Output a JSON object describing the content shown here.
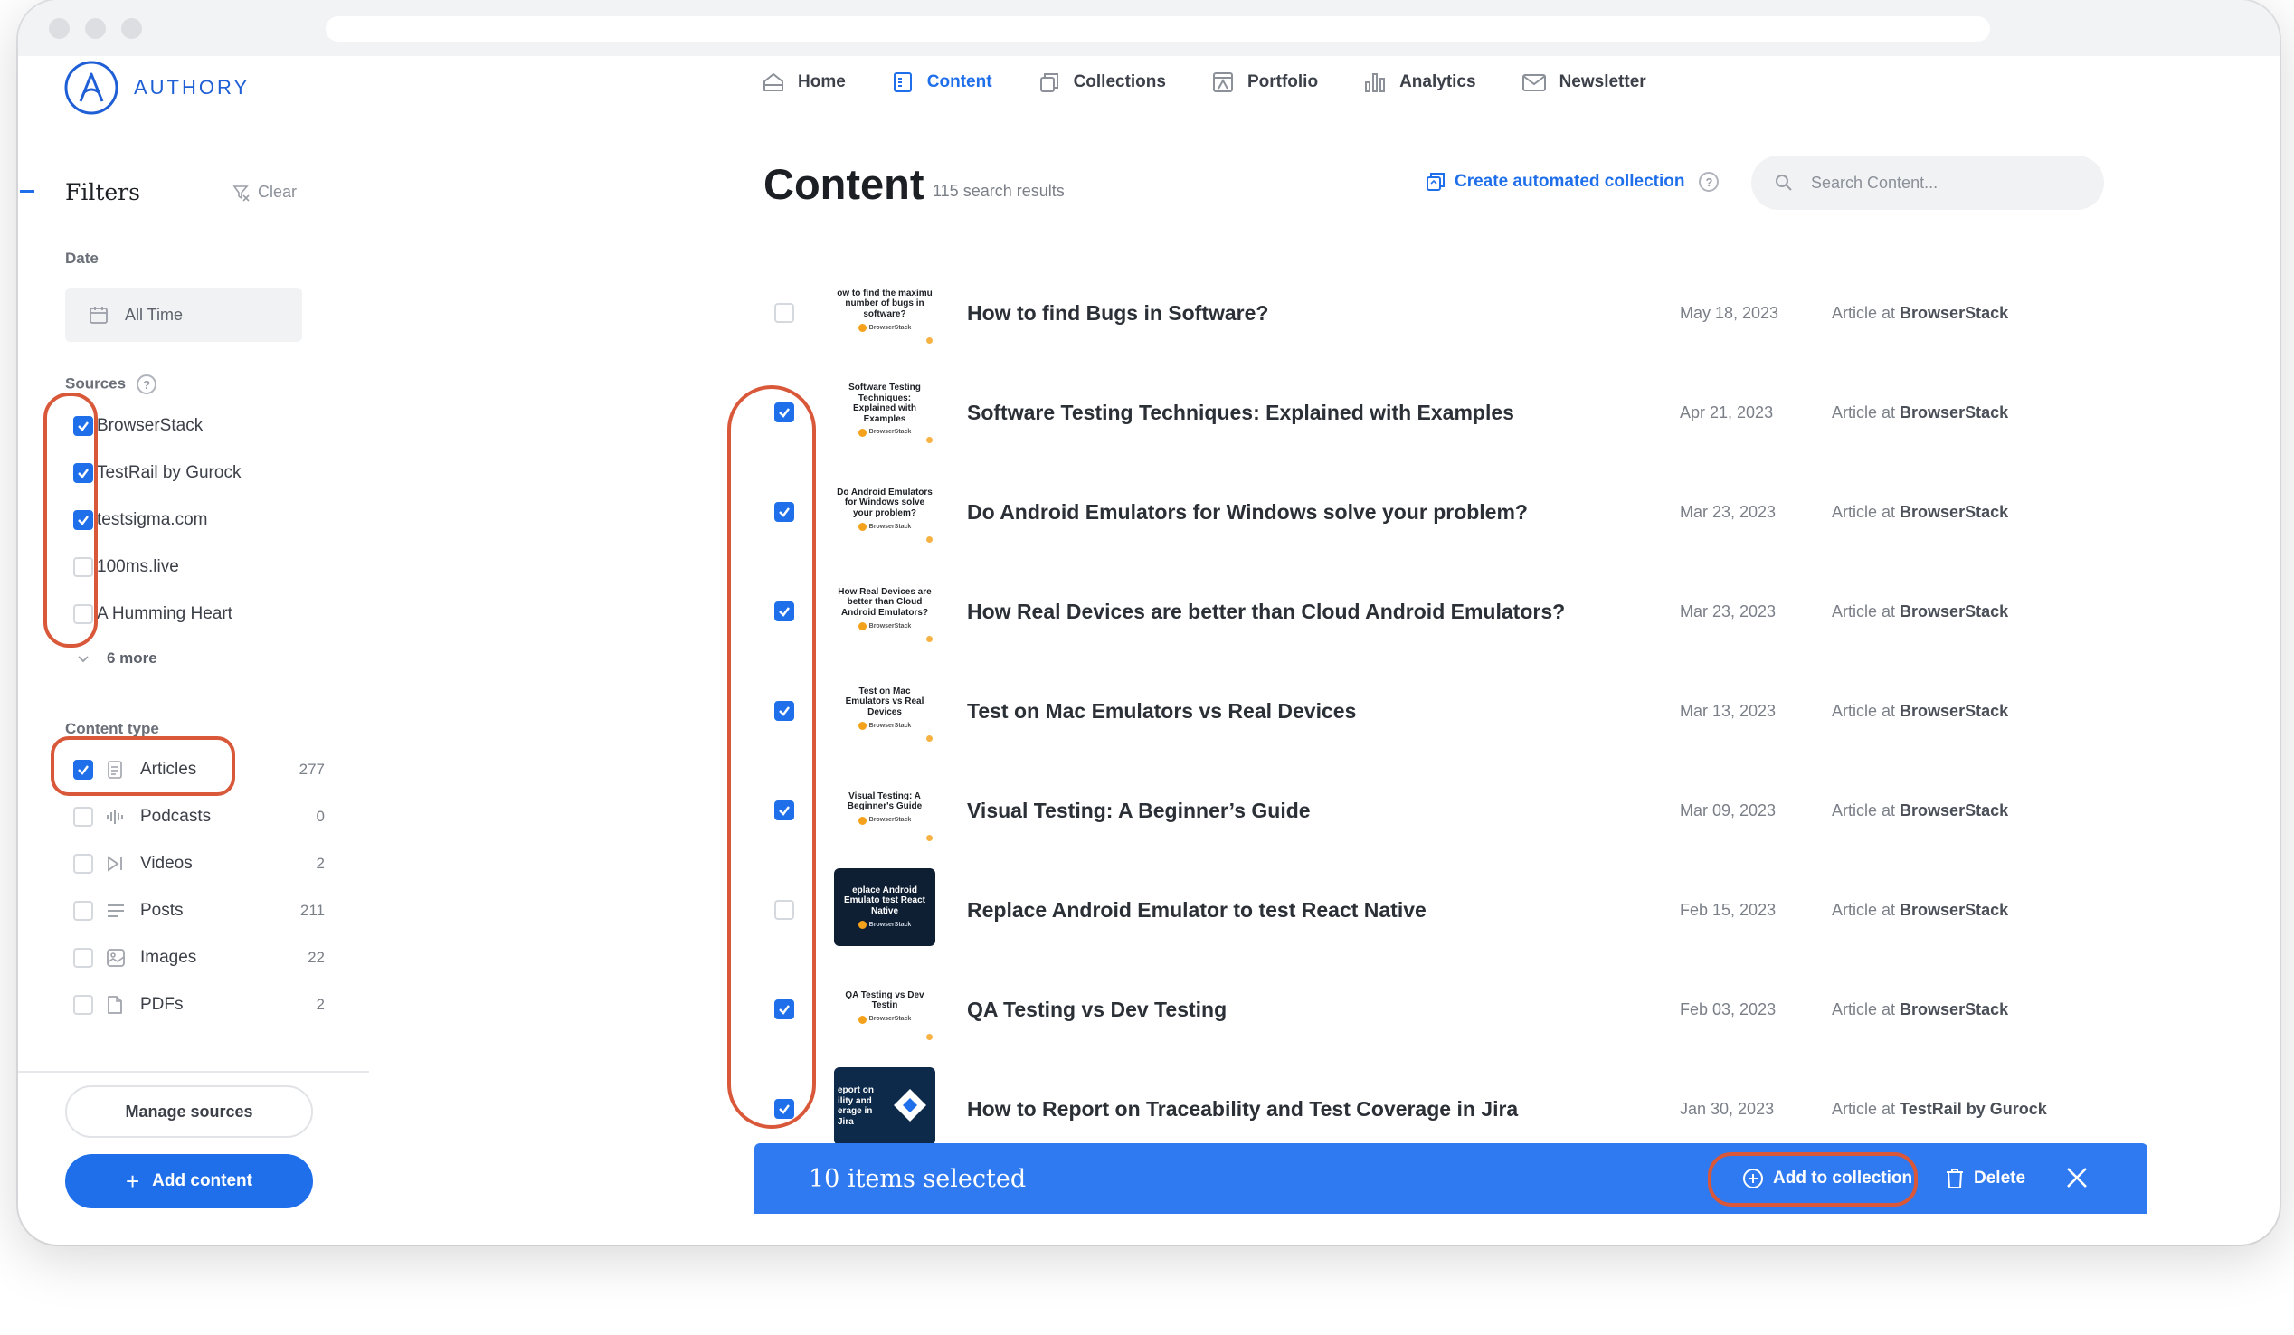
{
  "app": {
    "name": "AUTHORY"
  },
  "nav": [
    {
      "label": "Home",
      "icon": "home-icon"
    },
    {
      "label": "Content",
      "icon": "content-icon",
      "active": true
    },
    {
      "label": "Collections",
      "icon": "collections-icon"
    },
    {
      "label": "Portfolio",
      "icon": "portfolio-icon"
    },
    {
      "label": "Analytics",
      "icon": "analytics-icon"
    },
    {
      "label": "Newsletter",
      "icon": "newsletter-icon"
    }
  ],
  "sidebar": {
    "title": "Filters",
    "clear_label": "Clear",
    "date_label": "Date",
    "date_value": "All Time",
    "sources_label": "Sources",
    "sources_help": "?",
    "sources": [
      {
        "label": "BrowserStack",
        "checked": true
      },
      {
        "label": "TestRail by Gurock",
        "checked": true
      },
      {
        "label": "testsigma.com",
        "checked": true
      },
      {
        "label": "100ms.live",
        "checked": false
      },
      {
        "label": "A Humming Heart",
        "checked": false
      }
    ],
    "more_label": "6 more",
    "content_type_label": "Content type",
    "content_types": [
      {
        "label": "Articles",
        "count": "277",
        "checked": true,
        "icon": "article-icon"
      },
      {
        "label": "Podcasts",
        "count": "0",
        "checked": false,
        "icon": "podcast-icon"
      },
      {
        "label": "Videos",
        "count": "2",
        "checked": false,
        "icon": "video-icon"
      },
      {
        "label": "Posts",
        "count": "211",
        "checked": false,
        "icon": "posts-icon"
      },
      {
        "label": "Images",
        "count": "22",
        "checked": false,
        "icon": "image-icon"
      },
      {
        "label": "PDFs",
        "count": "2",
        "checked": false,
        "icon": "pdf-icon"
      }
    ],
    "manage_sources_label": "Manage sources",
    "add_content_label": "Add content"
  },
  "content": {
    "title": "Content",
    "results": "115 search results",
    "auto_collection_label": "Create automated collection",
    "search_placeholder": "Search Content...",
    "items": [
      {
        "title": "How to find Bugs in Software?",
        "date": "May 18, 2023",
        "type_prefix": "Article at",
        "source": "BrowserStack",
        "checked": false,
        "thumb_text": "ow to find the maximu number of bugs in software?",
        "thumb_style": "light"
      },
      {
        "title": "Software Testing Techniques: Explained with Examples",
        "date": "Apr 21, 2023",
        "type_prefix": "Article at",
        "source": "BrowserStack",
        "checked": true,
        "thumb_text": "Software Testing Techniques: Explained with Examples",
        "thumb_style": "light"
      },
      {
        "title": "Do Android Emulators for Windows solve your problem?",
        "date": "Mar 23, 2023",
        "type_prefix": "Article at",
        "source": "BrowserStack",
        "checked": true,
        "thumb_text": "Do Android Emulators for Windows solve your problem?",
        "thumb_style": "light"
      },
      {
        "title": "How Real Devices are better than Cloud Android Emulators?",
        "date": "Mar 23, 2023",
        "type_prefix": "Article at",
        "source": "BrowserStack",
        "checked": true,
        "thumb_text": "How Real Devices are better than Cloud Android Emulators?",
        "thumb_style": "light"
      },
      {
        "title": "Test on Mac Emulators vs Real Devices",
        "date": "Mar 13, 2023",
        "type_prefix": "Article at",
        "source": "BrowserStack",
        "checked": true,
        "thumb_text": "Test on Mac Emulators vs Real Devices",
        "thumb_style": "light"
      },
      {
        "title": "Visual Testing: A Beginner’s Guide",
        "date": "Mar 09, 2023",
        "type_prefix": "Article at",
        "source": "BrowserStack",
        "checked": true,
        "thumb_text": "Visual Testing: A Beginner's Guide",
        "thumb_style": "light"
      },
      {
        "title": "Replace Android Emulator to test React Native",
        "date": "Feb 15, 2023",
        "type_prefix": "Article at",
        "source": "BrowserStack",
        "checked": false,
        "thumb_text": "eplace Android Emulato test React Native",
        "thumb_style": "dark"
      },
      {
        "title": "QA Testing vs Dev Testing",
        "date": "Feb 03, 2023",
        "type_prefix": "Article at",
        "source": "BrowserStack",
        "checked": true,
        "thumb_text": "QA Testing vs Dev Testin",
        "thumb_style": "light"
      },
      {
        "title": "How to Report on Traceability and Test Coverage in Jira",
        "date": "Jan 30, 2023",
        "type_prefix": "Article at",
        "source": "TestRail by Gurock",
        "checked": true,
        "thumb_text": "eport on ility and erage in Jira",
        "thumb_style": "navy"
      }
    ]
  },
  "selection_bar": {
    "count_label": "10 items selected",
    "add_label": "Add to collection",
    "delete_label": "Delete"
  },
  "colors": {
    "accent": "#1f6feb",
    "selection_bar": "#2f7af0",
    "annotation": "#d9583a"
  }
}
